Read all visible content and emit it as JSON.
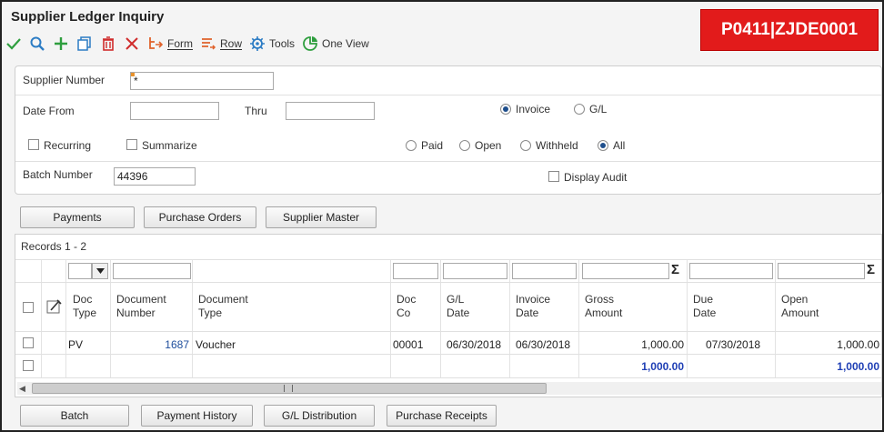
{
  "window": {
    "title": "Supplier Ledger Inquiry",
    "form_id": "P0411|ZJDE0001"
  },
  "toolbar": {
    "form_label": "Form",
    "row_label": "Row",
    "tools_label": "Tools",
    "oneview_label": "One View"
  },
  "criteria": {
    "supplier_number_label": "Supplier Number",
    "supplier_number_value": "*",
    "date_from_label": "Date From",
    "thru_label": "Thru",
    "invoice_label": "Invoice",
    "gl_label": "G/L",
    "recurring_label": "Recurring",
    "summarize_label": "Summarize",
    "paid_label": "Paid",
    "open_label": "Open",
    "withheld_label": "Withheld",
    "all_label": "All",
    "batch_number_label": "Batch Number",
    "batch_number_value": "44396",
    "display_audit_label": "Display Audit"
  },
  "top_buttons": {
    "payments": "Payments",
    "purchase_orders": "Purchase Orders",
    "supplier_master": "Supplier Master"
  },
  "grid": {
    "records_label": "Records  1 - 2",
    "columns": {
      "doc_type": "Doc\nType",
      "document_number": "Document\nNumber",
      "document_type": "Document\nType",
      "doc_co": "Doc\nCo",
      "gl_date": "G/L\nDate",
      "invoice_date": "Invoice\nDate",
      "gross_amount": "Gross\nAmount",
      "due_date": "Due\nDate",
      "open_amount": "Open\nAmount"
    },
    "row1": {
      "doc_type": "PV",
      "document_number": "1687",
      "document_type": "Voucher",
      "doc_co": "00001",
      "gl_date": "06/30/2018",
      "invoice_date": "06/30/2018",
      "gross_amount": "1,000.00",
      "due_date": "07/30/2018",
      "open_amount": "1,000.00"
    },
    "totals": {
      "gross_amount": "1,000.00",
      "open_amount": "1,000.00"
    }
  },
  "bottom_buttons": {
    "batch": "Batch",
    "payment_history": "Payment History",
    "gl_distribution": "G/L Distribution",
    "purchase_receipts": "Purchase Receipts"
  },
  "colors": {
    "form_id_bg": "#e21b1b",
    "total_text": "#1f3fb5",
    "link_text": "#1f4e9c"
  }
}
